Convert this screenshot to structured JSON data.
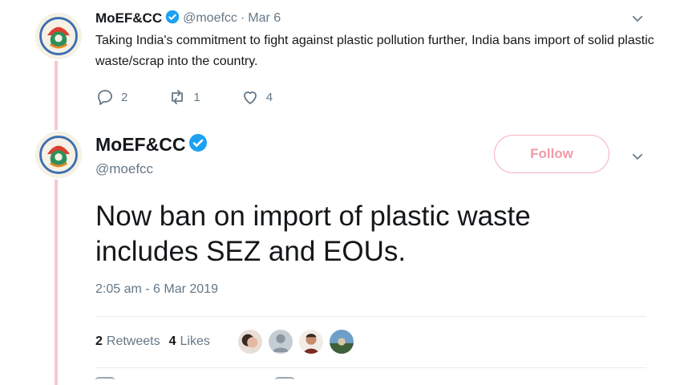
{
  "colors": {
    "accent": "#1da1f2",
    "follow_pink": "#f19aa8",
    "secondary_text": "#657786",
    "thread_line": "#f4c7cf"
  },
  "parent_tweet": {
    "name": "MoEF&CC",
    "handle": "@moefcc",
    "separator": "·",
    "date": "Mar 6",
    "text": "Taking India's commitment to fight against plastic pollution further, India bans import of solid plastic waste/scrap into the country.",
    "actions": {
      "reply": {
        "icon": "reply-icon",
        "count": "2"
      },
      "retweet": {
        "icon": "retweet-icon",
        "count": "1"
      },
      "like": {
        "icon": "heart-icon",
        "count": "4"
      }
    }
  },
  "main_tweet": {
    "name": "MoEF&CC",
    "handle": "@moefcc",
    "follow_label": "Follow",
    "text": "Now ban on import of plastic waste includes SEZ and EOUs.",
    "timestamp": "2:05 am - 6 Mar 2019",
    "stats": {
      "retweets_count": "2",
      "retweets_label": "Retweets",
      "likes_count": "4",
      "likes_label": "Likes"
    }
  }
}
